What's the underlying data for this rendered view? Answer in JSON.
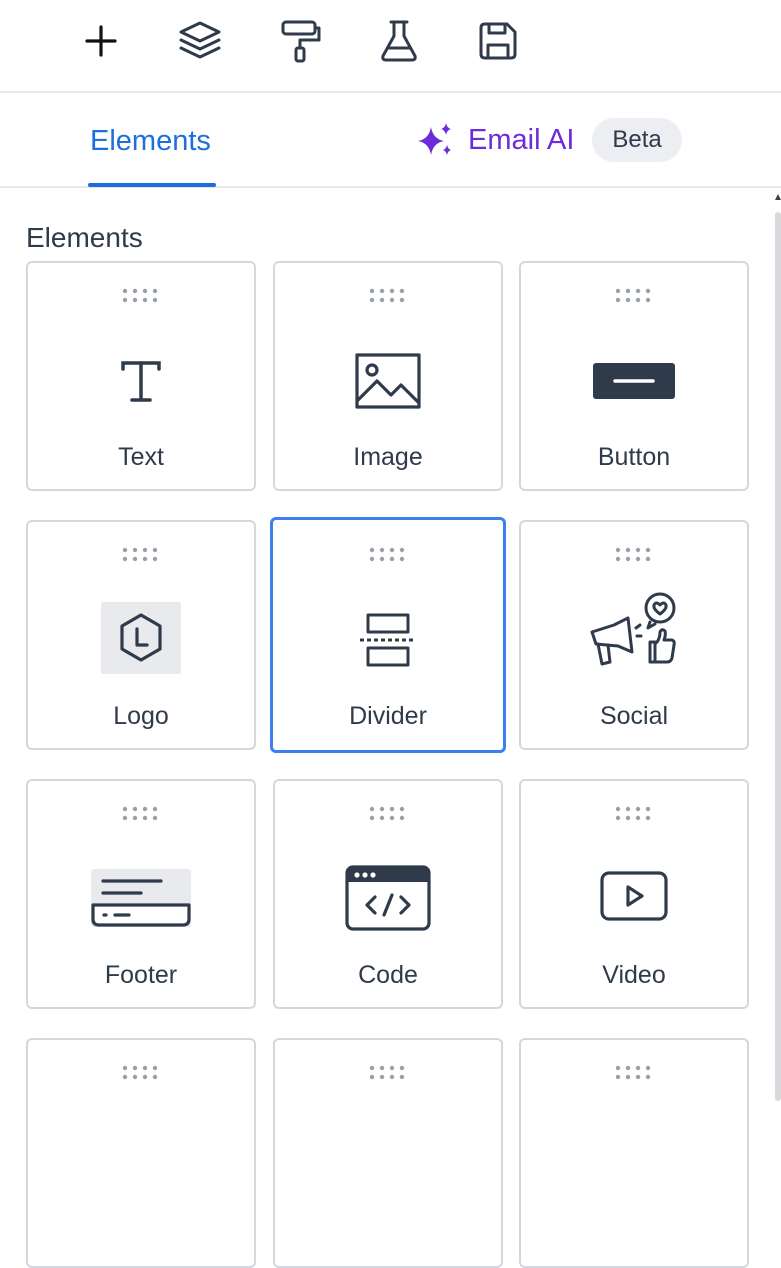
{
  "toolbar": {
    "icons": [
      "plus-icon",
      "layers-icon",
      "paint-roller-icon",
      "flask-icon",
      "save-icon"
    ]
  },
  "tabs": {
    "elements_label": "Elements",
    "email_ai_label": "Email AI",
    "beta_badge": "Beta"
  },
  "section": {
    "heading": "Elements"
  },
  "elements": [
    {
      "label": "Text",
      "icon": "text-icon"
    },
    {
      "label": "Image",
      "icon": "image-icon"
    },
    {
      "label": "Button",
      "icon": "button-icon"
    },
    {
      "label": "Logo",
      "icon": "logo-icon"
    },
    {
      "label": "Divider",
      "icon": "divider-icon",
      "selected": true
    },
    {
      "label": "Social",
      "icon": "social-icon"
    },
    {
      "label": "Footer",
      "icon": "footer-icon"
    },
    {
      "label": "Code",
      "icon": "code-icon"
    },
    {
      "label": "Video",
      "icon": "video-icon"
    }
  ],
  "colors": {
    "accent_blue": "#1d6fe0",
    "ai_purple": "#6d2bd9",
    "selected_border": "#3c7ff0",
    "icon_dark": "#2f3a4b"
  }
}
